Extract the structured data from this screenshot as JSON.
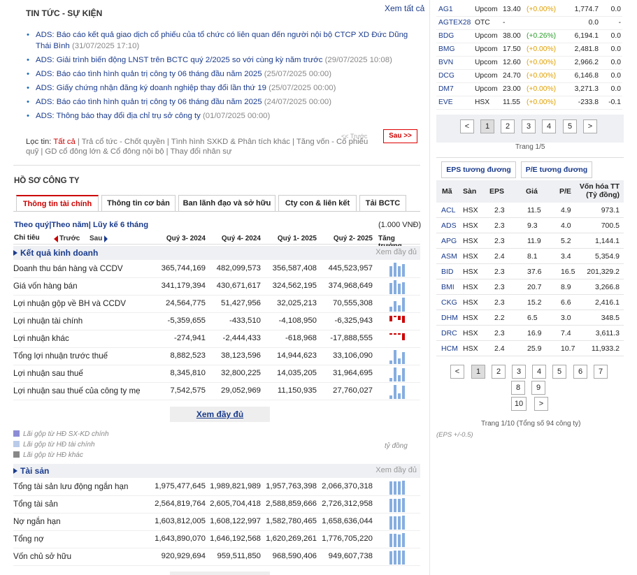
{
  "news": {
    "title": "TIN TỨC - SỰ KIỆN",
    "see_all": "Xem tất cả",
    "items": [
      {
        "text": "ADS: Báo cáo kết quả giao dịch cổ phiếu của tổ chức có liên quan đến người nội bộ CTCP XD Đức Dũng Thái Bình",
        "date": "(31/07/2025 17:10)"
      },
      {
        "text": "ADS: Giải trình biến động LNST trên BCTC quý 2/2025 so với cùng kỳ năm trước",
        "date": "(29/07/2025 10:08)"
      },
      {
        "text": "ADS: Báo cáo tình hình quản trị công ty 06 tháng đầu năm 2025",
        "date": "(25/07/2025 00:00)"
      },
      {
        "text": "ADS: Giấy chứng nhận đăng ký doanh nghiệp thay đổi lần thứ 19",
        "date": "(25/07/2025 00:00)"
      },
      {
        "text": "ADS: Báo cáo tình hình quản trị công ty 06 tháng đầu năm 2025",
        "date": "(24/07/2025 00:00)"
      },
      {
        "text": "ADS: Thông báo thay đổi địa chỉ trụ sở công ty",
        "date": "(01/07/2025 00:00)"
      }
    ],
    "filter_label": "Lọc tin:",
    "filter_active": "Tất cả",
    "filter_rest": " | Trả cổ tức - Chốt quyền | Tình hình SXKD & Phân tích khác | Tăng vốn - Cổ phiếu quỹ | GD cổ đông lớn & Cổ đông nội bộ | Thay đổi nhân sự",
    "prev": "<< Trước",
    "next": "Sau >>"
  },
  "profile": {
    "title": "HỒ SƠ CÔNG TY",
    "tabs": [
      "Thông tin tài chính",
      "Thông tin cơ bản",
      "Ban lãnh đạo và sở hữu",
      "Cty con & liên kết",
      "Tải BCTC"
    ],
    "period": "Theo quý|Theo năm| Lũy kế 6 tháng",
    "unit": "(1.000 VNĐ)",
    "hdr": {
      "label": "Chỉ tiêu",
      "prev": "Trước",
      "next": "Sau",
      "q": [
        "Quý 3- 2024",
        "Quý 4- 2024",
        "Quý 1- 2025",
        "Quý 2- 2025"
      ],
      "growth": "Tăng trưởng"
    },
    "sec1": {
      "title": "Kết quả kinh doanh",
      "more": "Xem đầy đủ",
      "rows": [
        {
          "name": "Doanh thu bán hàng và CCDV",
          "v": [
            "365,744,169",
            "482,099,573",
            "356,587,408",
            "445,523,957"
          ]
        },
        {
          "name": "Giá vốn hàng bán",
          "v": [
            "341,179,394",
            "430,671,617",
            "324,562,195",
            "374,968,649"
          ]
        },
        {
          "name": "Lợi nhuận gộp về BH và CCDV",
          "v": [
            "24,564,775",
            "51,427,956",
            "32,025,213",
            "70,555,308"
          ]
        },
        {
          "name": "Lợi nhuận tài chính",
          "v": [
            "-5,359,655",
            "-433,510",
            "-4,108,950",
            "-6,325,943"
          ]
        },
        {
          "name": "Lợi nhuận khác",
          "v": [
            "-274,941",
            "-2,444,433",
            "-618,968",
            "-17,888,555"
          ]
        },
        {
          "name": "Tổng lợi nhuận trước thuế",
          "v": [
            "8,882,523",
            "38,123,596",
            "14,944,623",
            "33,106,090"
          ]
        },
        {
          "name": "Lợi nhuận sau thuế",
          "v": [
            "8,345,810",
            "32,800,225",
            "14,035,205",
            "31,964,695"
          ]
        },
        {
          "name": "Lợi nhuận sau thuế của công ty mẹ",
          "v": [
            "7,542,575",
            "29,052,969",
            "11,150,935",
            "27,760,027"
          ]
        }
      ]
    },
    "more_btn": "Xem đầy đủ",
    "legend": [
      "Lãi gộp từ HĐ SX-KD chính",
      "Lãi gộp từ HĐ tài chính",
      "Lãi gộp từ HĐ khác"
    ],
    "unit2": "tỷ đồng",
    "sec2": {
      "title": "Tài sản",
      "more": "Xem đầy đủ",
      "rows": [
        {
          "name": "Tổng tài sản lưu động ngắn hạn",
          "v": [
            "1,975,477,645",
            "1,989,821,989",
            "1,957,763,398",
            "2,066,370,318"
          ]
        },
        {
          "name": "Tổng tài sản",
          "v": [
            "2,564,819,764",
            "2,605,704,418",
            "2,588,859,666",
            "2,726,312,958"
          ]
        },
        {
          "name": "Nợ ngắn hạn",
          "v": [
            "1,603,812,005",
            "1,608,122,997",
            "1,582,780,465",
            "1,658,636,044"
          ]
        },
        {
          "name": "Tổng nợ",
          "v": [
            "1,643,890,070",
            "1,646,192,568",
            "1,620,269,261",
            "1,776,705,220"
          ]
        },
        {
          "name": "Vốn chủ sở hữu",
          "v": [
            "920,929,694",
            "959,511,850",
            "968,590,406",
            "949,607,738"
          ]
        }
      ]
    }
  },
  "quotes": [
    {
      "s": "AG1",
      "ex": "Upcom",
      "p": "13.40",
      "c": "(+0.00%)",
      "vol": "1,774.7",
      "x": "0.0",
      "cls": "ref"
    },
    {
      "s": "AGTEX28",
      "ex": "OTC",
      "p": "-",
      "c": "",
      "vol": "0.0",
      "x": "-",
      "cls": "ref"
    },
    {
      "s": "BDG",
      "ex": "Upcom",
      "p": "38.00",
      "c": "(+0.26%)",
      "vol": "6,194.1",
      "x": "0.0",
      "cls": "up"
    },
    {
      "s": "BMG",
      "ex": "Upcom",
      "p": "17.50",
      "c": "(+0.00%)",
      "vol": "2,481.8",
      "x": "0.0",
      "cls": "ref"
    },
    {
      "s": "BVN",
      "ex": "Upcom",
      "p": "12.60",
      "c": "(+0.00%)",
      "vol": "2,966.2",
      "x": "0.0",
      "cls": "ref"
    },
    {
      "s": "DCG",
      "ex": "Upcom",
      "p": "24.70",
      "c": "(+0.00%)",
      "vol": "6,146.8",
      "x": "0.0",
      "cls": "ref"
    },
    {
      "s": "DM7",
      "ex": "Upcom",
      "p": "23.00",
      "c": "(+0.00%)",
      "vol": "3,271.3",
      "x": "0.0",
      "cls": "ref"
    },
    {
      "s": "EVE",
      "ex": "HSX",
      "p": "11.55",
      "c": "(+0.00%)",
      "vol": "-233.8",
      "x": "-0.1",
      "cls": "ref"
    }
  ],
  "qpager": {
    "pages": [
      "1",
      "2",
      "3",
      "4",
      "5"
    ],
    "prev": "<",
    "next": ">",
    "label": "Trang 1/5"
  },
  "eps": {
    "tabs": [
      "EPS tương đương",
      "P/E tương đương"
    ],
    "hdr": [
      "Mã",
      "Sàn",
      "EPS",
      "Giá",
      "P/E",
      "Vốn hóa TT (Tỷ đồng)"
    ],
    "rows": [
      [
        "ACL",
        "HSX",
        "2.3",
        "11.5",
        "4.9",
        "973.1"
      ],
      [
        "ADS",
        "HSX",
        "2.3",
        "9.3",
        "4.0",
        "700.5"
      ],
      [
        "APG",
        "HSX",
        "2.3",
        "11.9",
        "5.2",
        "1,144.1"
      ],
      [
        "ASM",
        "HSX",
        "2.4",
        "8.1",
        "3.4",
        "5,354.9"
      ],
      [
        "BID",
        "HSX",
        "2.3",
        "37.6",
        "16.5",
        "201,329.2"
      ],
      [
        "BMI",
        "HSX",
        "2.3",
        "20.7",
        "8.9",
        "3,266.8"
      ],
      [
        "CKG",
        "HSX",
        "2.3",
        "15.2",
        "6.6",
        "2,416.1"
      ],
      [
        "DHM",
        "HSX",
        "2.2",
        "6.5",
        "3.0",
        "348.5"
      ],
      [
        "DRC",
        "HSX",
        "2.3",
        "16.9",
        "7.4",
        "3,611.3"
      ],
      [
        "HCM",
        "HSX",
        "2.4",
        "25.9",
        "10.7",
        "11,933.2"
      ]
    ],
    "pages": [
      "1",
      "2",
      "3",
      "4",
      "5",
      "6",
      "7",
      "8",
      "9",
      "10"
    ],
    "prev": "<",
    "next": ">",
    "label": "Trang 1/10 (Tổng số 94 công ty)",
    "note": "(EPS +/-0.5)"
  },
  "colors": {
    "link": "#1a3b8c",
    "red": "#cc0000",
    "bar": "#86aee0",
    "barNeg": "#cc0000"
  }
}
